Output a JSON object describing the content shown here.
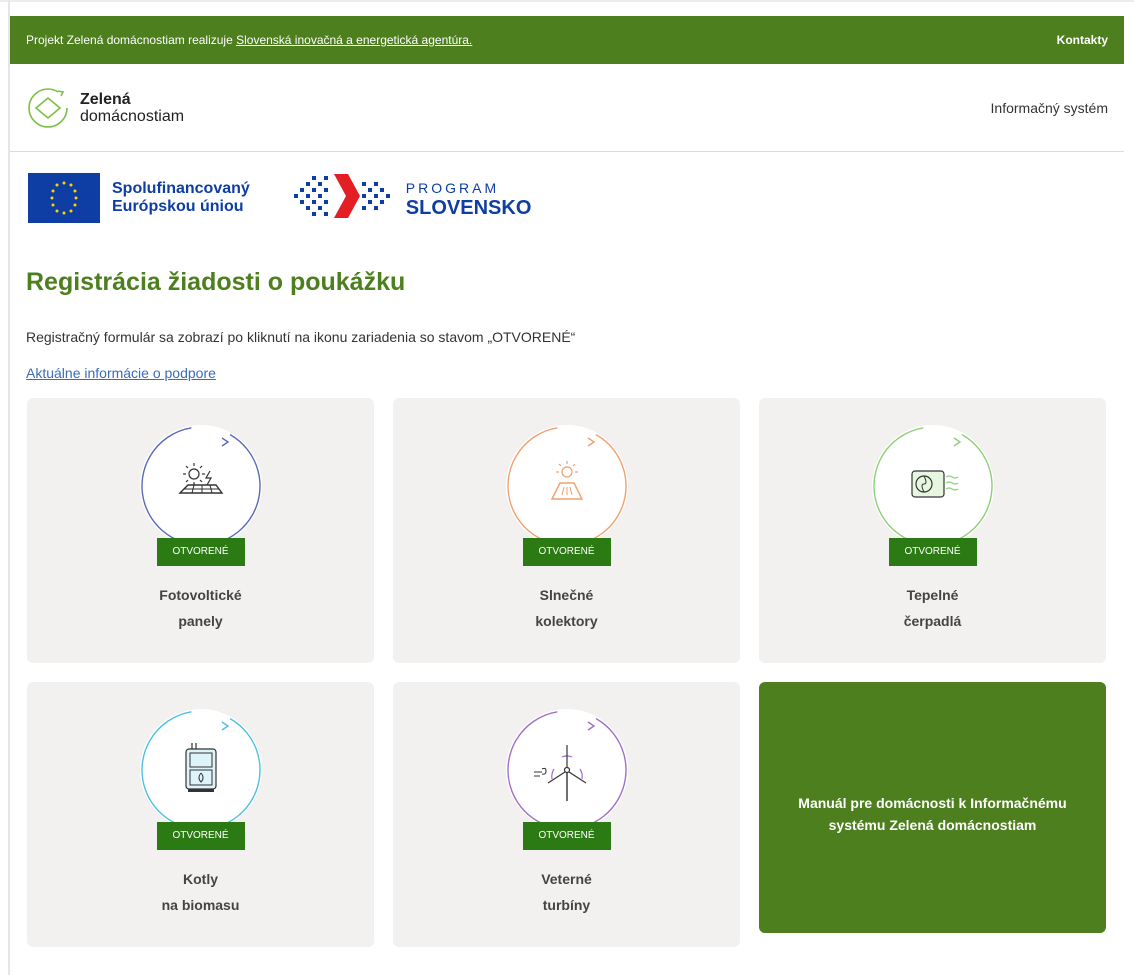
{
  "topbar": {
    "prefix": "Projekt Zelená domácnostiam realizuje ",
    "agency_link": "Slovenská inovačná a energetická agentúra.",
    "contacts": "Kontakty"
  },
  "header": {
    "logo_line1": "Zelená",
    "logo_line2": "domácnostiam",
    "info_system": "Informačný systém"
  },
  "funding": {
    "eu_line1": "Spolufinancovaný",
    "eu_line2": "Európskou úniou",
    "program_line1": "PROGRAM",
    "program_line2": "SLOVENSKO"
  },
  "main": {
    "title": "Registrácia žiadosti o poukážku",
    "intro": "Registračný formulár sa zobrazí po kliknutí na ikonu zariadenia so stavom „OTVORENÉ“",
    "news_link": "Aktuálne informácie o podpore"
  },
  "cards": [
    {
      "line1": "Fotovoltické",
      "line2": "panely",
      "status": "OTVORENÉ",
      "icon": "solar-panel-icon",
      "color": "#5a6bb5"
    },
    {
      "line1": "Slnečné",
      "line2": "kolektory",
      "status": "OTVORENÉ",
      "icon": "solar-collector-icon",
      "color": "#f0a070"
    },
    {
      "line1": "Tepelné",
      "line2": "čerpadlá",
      "status": "OTVORENÉ",
      "icon": "heat-pump-icon",
      "color": "#8fcf7a"
    },
    {
      "line1": "Kotly",
      "line2": "na biomasu",
      "status": "OTVORENÉ",
      "icon": "biomass-boiler-icon",
      "color": "#4ec0e0"
    },
    {
      "line1": "Veterné",
      "line2": "turbíny",
      "status": "OTVORENÉ",
      "icon": "wind-turbine-icon",
      "color": "#a070c8"
    }
  ],
  "manual": {
    "line1": "Manuál pre domácnosti k Informačnému",
    "line2": "systému Zelená domácnostiam"
  },
  "colors": {
    "brand_green": "#4d7f1e",
    "status_green": "#2b7a14",
    "eu_blue": "#0e3ea3",
    "link_blue": "#3a6cb8",
    "card_bg": "#f2f1f0"
  }
}
